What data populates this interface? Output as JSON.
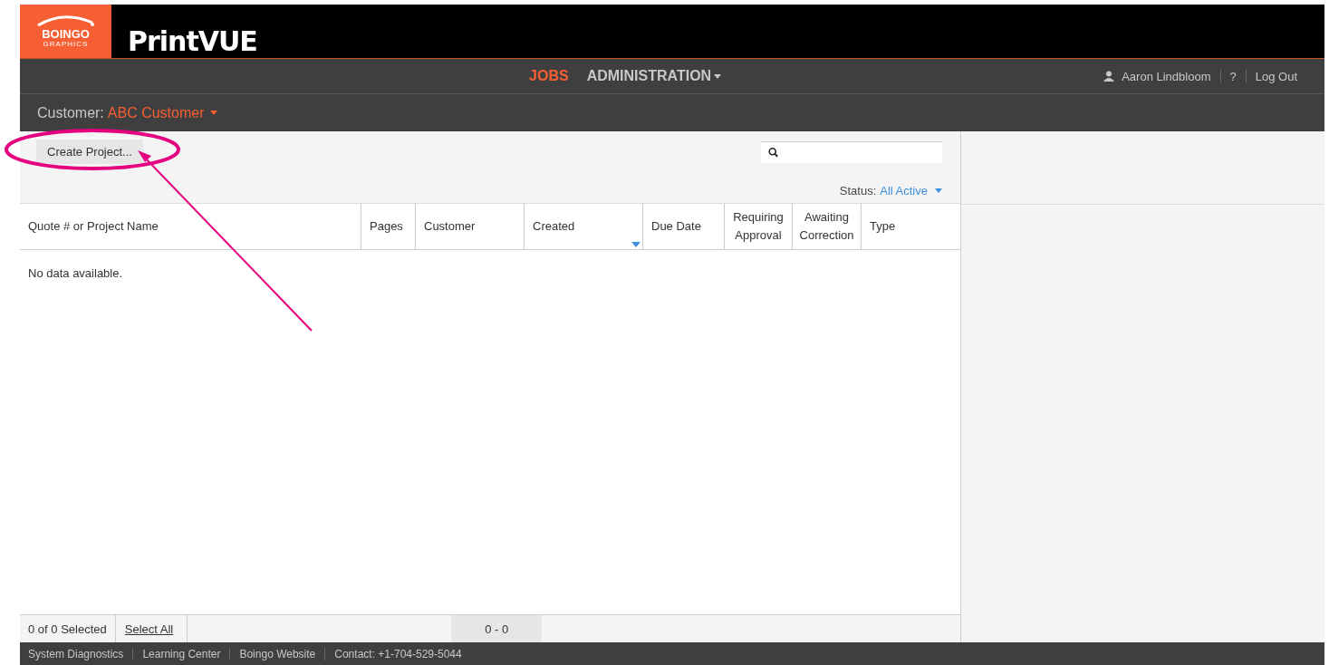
{
  "logo": {
    "brand": "BOINGO",
    "brand_sub": "GRAPHICS",
    "product": "PrintVUE"
  },
  "nav": {
    "items": [
      {
        "label": "JOBS",
        "selected": true,
        "dropdown": false
      },
      {
        "label": "ADMINISTRATION",
        "selected": false,
        "dropdown": true
      }
    ],
    "user": "Aaron Lindbloom",
    "help": "?",
    "logout": "Log Out"
  },
  "customer_bar": {
    "label": "Customer:",
    "value": "ABC Customer"
  },
  "toolbar": {
    "create_button": "Create Project...",
    "status_label": "Status:",
    "status_value": "All Active"
  },
  "table": {
    "columns": [
      {
        "label": "Quote # or Project Name",
        "sorted": false
      },
      {
        "label": "Pages",
        "sorted": false
      },
      {
        "label": "Customer",
        "sorted": false
      },
      {
        "label": "Created",
        "sorted": true
      },
      {
        "label": "Due Date",
        "sorted": false
      },
      {
        "label": "Requiring Approval",
        "sorted": false
      },
      {
        "label": "Awaiting Correction",
        "sorted": false
      },
      {
        "label": "Type",
        "sorted": false
      }
    ],
    "empty_message": "No data available."
  },
  "table_footer": {
    "selected_count": "0 of 0 Selected",
    "select_all": "Select All",
    "range": "0 - 0"
  },
  "footer_links": [
    "System Diagnostics",
    "Learning Center",
    "Boingo Website",
    "Contact: +1-704-529-5044"
  ],
  "annotation": {
    "kind": "ellipse-arrow"
  }
}
